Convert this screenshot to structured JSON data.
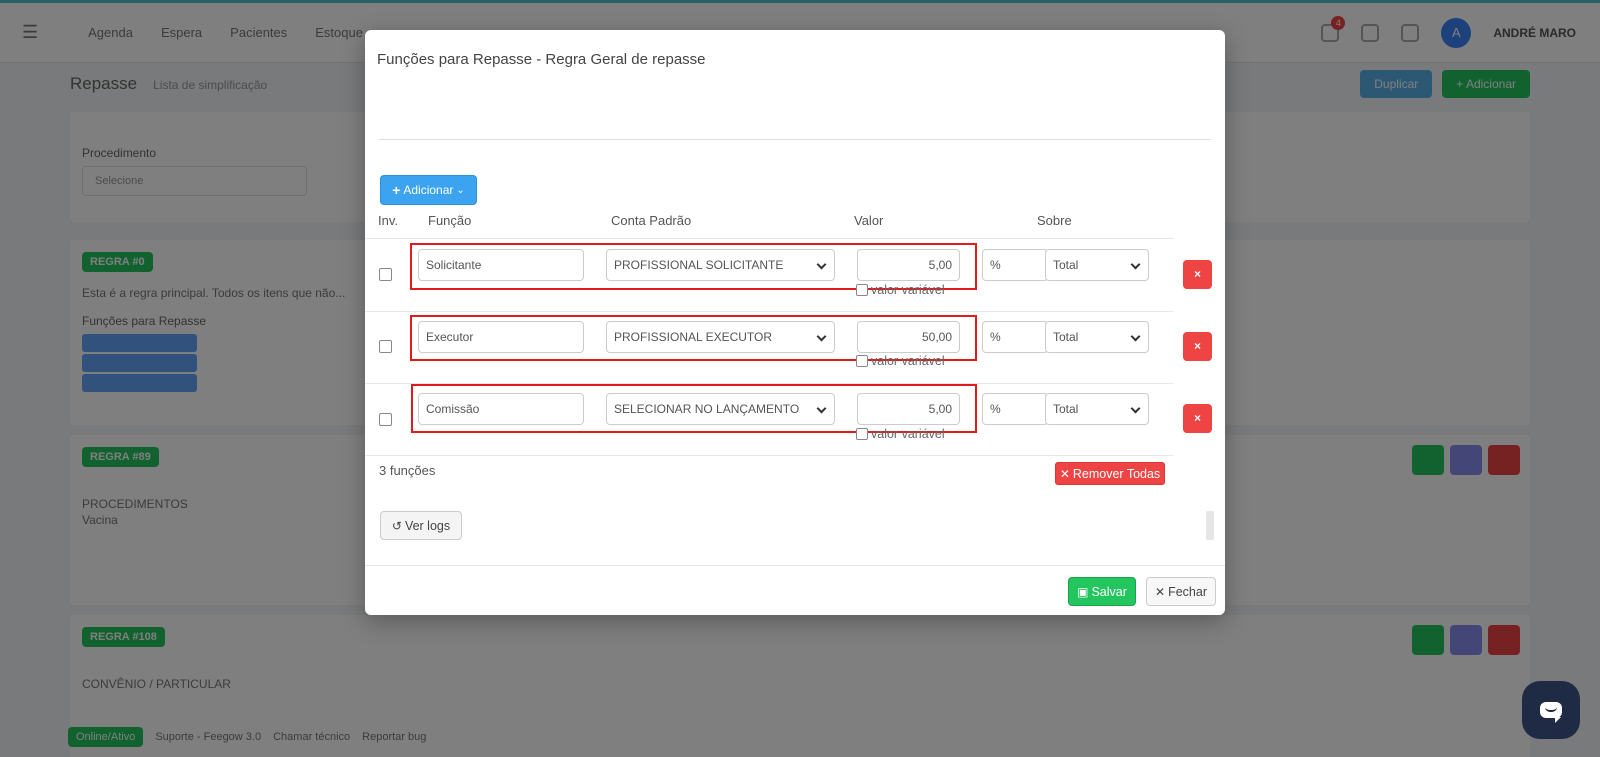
{
  "background": {
    "nav": [
      "Agenda",
      "Espera",
      "Pacientes",
      "Estoque"
    ],
    "user_initial": "A",
    "user_name": "ANDRÉ MARO",
    "notif_count": "4",
    "page_title": "Repasse",
    "page_subtitle": "Lista de simplificação",
    "btn_1": "Duplicar",
    "btn_2": "+ Adicionar",
    "label_procedimento": "Procedimento",
    "select_placeholder": "Selecione",
    "tag_1": "REGRA #0",
    "text_1": "Esta é a regra principal. Todos os itens que não...",
    "label_funcoes": "Funções para Repasse",
    "tag_2": "REGRA #89",
    "text_procedimentos": "PROCEDIMENTOS",
    "text_nenhum": "Vacina",
    "tag_3": "REGRA #108",
    "text_convenio": "CONVÊNIO / PARTICULAR",
    "footer_pill": "Online/Ativo",
    "footer_1": "Suporte - Feegow 3.0",
    "footer_2": "Chamar técnico",
    "footer_3": "Reportar bug"
  },
  "modal": {
    "title": "Funções para Repasse - Regra Geral de repasse",
    "add_button": "Adicionar",
    "headers": {
      "inv": "Inv.",
      "funcao": "Função",
      "conta": "Conta Padrão",
      "valor": "Valor",
      "sobre": "Sobre"
    },
    "rows": [
      {
        "funcao": "Solicitante",
        "conta": "PROFISSIONAL SOLICITANTE",
        "valor": "5,00",
        "unidade": "%",
        "sobre": "Total",
        "variavel": "valor variável"
      },
      {
        "funcao": "Executor",
        "conta": "PROFISSIONAL EXECUTOR",
        "valor": "50,00",
        "unidade": "%",
        "sobre": "Total",
        "variavel": "valor variável"
      },
      {
        "funcao": "Comissão",
        "conta": "SELECIONAR NO LANÇAMENTO",
        "valor": "5,00",
        "unidade": "%",
        "sobre": "Total",
        "variavel": "valor variável"
      }
    ],
    "delete_glyph": "×",
    "count": "3 funções",
    "remove_all": "Remover Todas",
    "logs": "Ver logs",
    "save": "Salvar",
    "close": "Fechar"
  },
  "colors": {
    "primary": "#3ba3ef",
    "danger": "#ef4444",
    "success": "#22c55e",
    "highlight": "#e01b1b",
    "chat": "#1f2a44"
  },
  "icons": [
    "menu-icon",
    "plus-icon",
    "chevron-down-icon",
    "close-icon",
    "history-icon",
    "save-icon",
    "chat-icon"
  ]
}
